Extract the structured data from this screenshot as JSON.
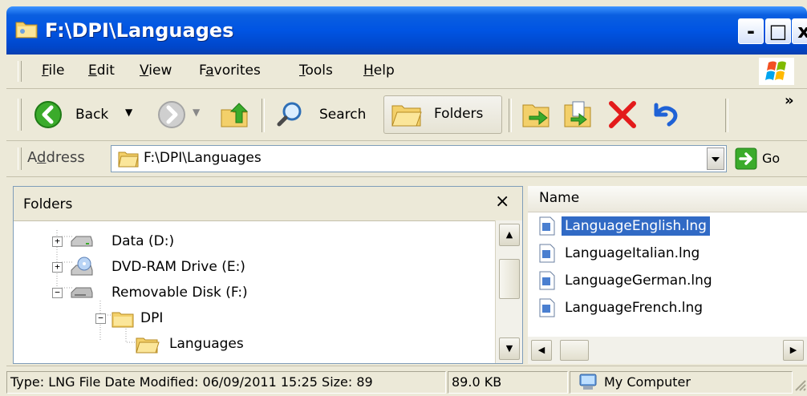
{
  "window": {
    "title": "F:\\DPI\\Languages",
    "controls": {
      "minimize": "-",
      "maximize": "□",
      "close": "x"
    }
  },
  "menu": [
    {
      "label": "File",
      "u": "F",
      "rest": "ile"
    },
    {
      "label": "Edit",
      "u": "E",
      "rest": "dit"
    },
    {
      "label": "View",
      "u": "V",
      "rest": "iew"
    },
    {
      "label": "Favorites",
      "u": "a",
      "pre": "F",
      "rest": "vorites"
    },
    {
      "label": "Tools",
      "u": "T",
      "rest": "ools"
    },
    {
      "label": "Help",
      "u": "H",
      "rest": "elp"
    }
  ],
  "toolbar": {
    "back_label": "Back",
    "search_label": "Search",
    "folders_label": "Folders",
    "overflow": "»"
  },
  "address": {
    "label_pre": "A",
    "label_u": "d",
    "label_rest": "dress",
    "value": "F:\\DPI\\Languages",
    "go_label": "Go"
  },
  "folders_pane": {
    "title": "Folders",
    "close": "×",
    "tree": [
      {
        "label": "Data (D:)",
        "icon": "hard-drive-icon",
        "expander": "+"
      },
      {
        "label": "DVD-RAM Drive (E:)",
        "icon": "dvd-drive-icon",
        "expander": "+"
      },
      {
        "label": "Removable Disk (F:)",
        "icon": "removable-disk-icon",
        "expander": "−"
      },
      {
        "label": "DPI",
        "icon": "folder-icon",
        "expander": "−"
      },
      {
        "label": "Languages",
        "icon": "folder-open-icon",
        "expander": ""
      }
    ]
  },
  "files_pane": {
    "column_name": "Name",
    "files": [
      {
        "name": "LanguageEnglish.lng",
        "selected": true
      },
      {
        "name": "LanguageItalian.lng",
        "selected": false
      },
      {
        "name": "LanguageGerman.lng",
        "selected": false
      },
      {
        "name": "LanguageFrench.lng",
        "selected": false
      }
    ]
  },
  "status": {
    "info": "Type: LNG File Date Modified: 06/09/2011 15:25 Size: 89",
    "size": "89.0 KB",
    "zone": "My Computer"
  },
  "colors": {
    "title_bar": "#0054e3",
    "selection": "#316ac5",
    "chrome": "#ece9d8"
  }
}
